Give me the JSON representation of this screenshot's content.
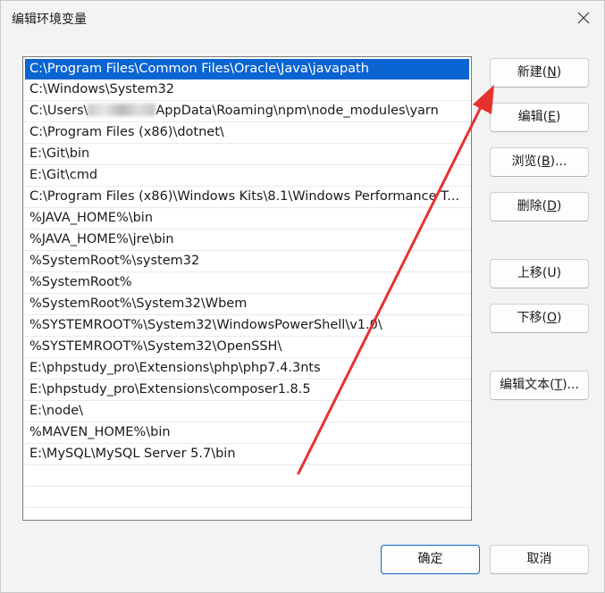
{
  "window": {
    "title": "编辑环境变量"
  },
  "path_list": {
    "items": [
      "C:\\Program Files\\Common Files\\Oracle\\Java\\javapath",
      "C:\\Windows\\System32",
      "AppData\\Roaming\\npm\\node_modules\\yarn",
      "C:\\Program Files (x86)\\dotnet\\",
      "E:\\Git\\bin",
      "E:\\Git\\cmd",
      "C:\\Program Files (x86)\\Windows Kits\\8.1\\Windows Performance T...",
      "%JAVA_HOME%\\bin",
      "%JAVA_HOME%\\jre\\bin",
      "%SystemRoot%\\system32",
      "%SystemRoot%",
      "%SystemRoot%\\System32\\Wbem",
      "%SYSTEMROOT%\\System32\\WindowsPowerShell\\v1.0\\",
      "%SYSTEMROOT%\\System32\\OpenSSH\\",
      "E:\\phpstudy_pro\\Extensions\\php\\php7.4.3nts",
      "E:\\phpstudy_pro\\Extensions\\composer1.8.5",
      "E:\\node\\",
      "%MAVEN_HOME%\\bin",
      "E:\\MySQL\\MySQL Server 5.7\\bin"
    ],
    "item3_prefix": "C:\\Users\\",
    "selected_index": 0
  },
  "buttons": {
    "new": {
      "label": "新建(",
      "key": "N",
      "suffix": ")"
    },
    "edit": {
      "label": "编辑(",
      "key": "E",
      "suffix": ")"
    },
    "browse": {
      "label": "浏览(",
      "key": "B",
      "suffix": ")..."
    },
    "delete": {
      "label": "删除(",
      "key": "D",
      "suffix": ")"
    },
    "move_up": {
      "label": "上移(",
      "key": "U",
      "suffix": ")"
    },
    "move_down": {
      "label": "下移(",
      "key": "O",
      "suffix": ")"
    },
    "edit_text": {
      "label": "编辑文本(",
      "key": "T",
      "suffix": ")..."
    },
    "ok": "确定",
    "cancel": "取消"
  },
  "colors": {
    "selection": "#0a64d2",
    "annotation_arrow": "#e8312f"
  },
  "icons": {
    "close": "close-icon"
  }
}
